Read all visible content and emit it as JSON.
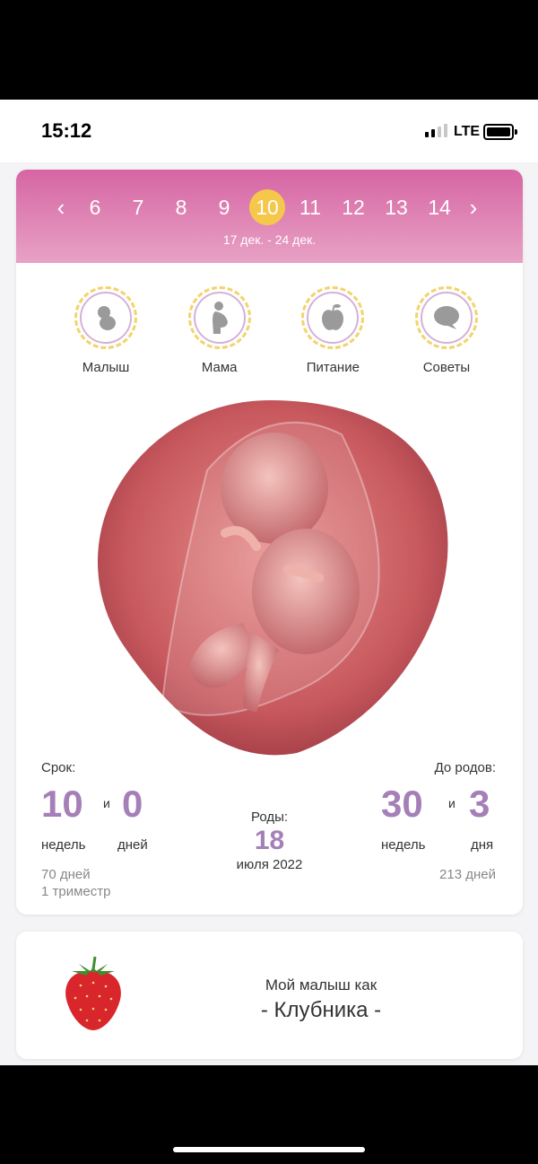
{
  "status_bar": {
    "time": "15:12",
    "network": "LTE"
  },
  "week_selector": {
    "weeks": [
      "6",
      "7",
      "8",
      "9",
      "10",
      "11",
      "12",
      "13",
      "14"
    ],
    "active_week": "10",
    "date_range": "17 дек. - 24 дек."
  },
  "categories": [
    {
      "label": "Малыш",
      "icon": "baby-icon"
    },
    {
      "label": "Мама",
      "icon": "pregnant-woman-icon"
    },
    {
      "label": "Питание",
      "icon": "apple-icon"
    },
    {
      "label": "Советы",
      "icon": "speech-bubble-icon"
    }
  ],
  "term": {
    "label": "Срок:",
    "weeks": "10",
    "and": "и",
    "days": "0",
    "weeks_unit": "недель",
    "days_unit": "дней",
    "total_days": "70 дней",
    "trimester": "1 триместр"
  },
  "due": {
    "label": "Роды:",
    "day": "18",
    "month_year": "июля 2022"
  },
  "until_birth": {
    "label": "До родов:",
    "weeks": "30",
    "and": "и",
    "days": "3",
    "weeks_unit": "недель",
    "days_unit": "дня",
    "total_days": "213 дней"
  },
  "fruit": {
    "line1": "Мой малыш как",
    "line2": "- Клубника -"
  },
  "colors": {
    "header_top": "#d665a3",
    "header_bottom": "#e8a2c5",
    "active_week": "#f5c84c",
    "accent_number": "#a57fb8"
  }
}
